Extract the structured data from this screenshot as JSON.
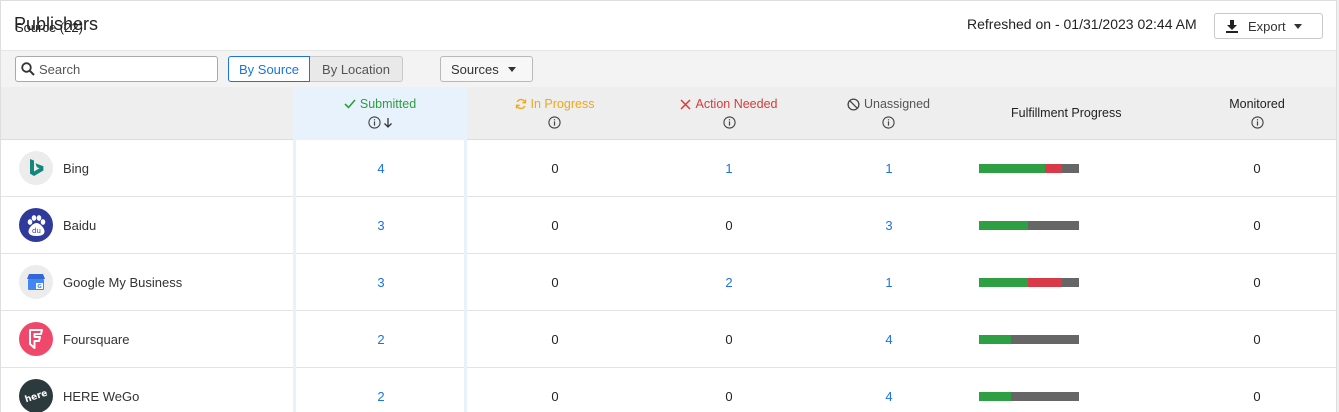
{
  "header": {
    "title": "Publishers",
    "refreshed": "Refreshed on - 01/31/2023 02:44 AM",
    "export_label": "Export"
  },
  "toolbar": {
    "search_placeholder": "Search",
    "by_source": "By Source",
    "by_location": "By Location",
    "sources": "Sources"
  },
  "table": {
    "headers": {
      "source": "Source (22)",
      "submitted": "Submitted",
      "in_progress": "In Progress",
      "action_needed": "Action Needed",
      "unassigned": "Unassigned",
      "fulfillment": "Fulfillment Progress",
      "monitored": "Monitored"
    },
    "rows": [
      {
        "name": "Bing",
        "submitted": "4",
        "in_progress": "0",
        "action_needed": "1",
        "unassigned": "1",
        "monitored": "0",
        "progress": {
          "green": 0.66,
          "red": 0.17
        }
      },
      {
        "name": "Baidu",
        "submitted": "3",
        "in_progress": "0",
        "action_needed": "0",
        "unassigned": "3",
        "monitored": "0",
        "progress": {
          "green": 0.49,
          "red": 0.0
        }
      },
      {
        "name": "Google My Business",
        "submitted": "3",
        "in_progress": "0",
        "action_needed": "2",
        "unassigned": "1",
        "monitored": "0",
        "progress": {
          "green": 0.49,
          "red": 0.34
        }
      },
      {
        "name": "Foursquare",
        "submitted": "2",
        "in_progress": "0",
        "action_needed": "0",
        "unassigned": "4",
        "monitored": "0",
        "progress": {
          "green": 0.32,
          "red": 0.0
        }
      },
      {
        "name": "HERE WeGo",
        "submitted": "2",
        "in_progress": "0",
        "action_needed": "0",
        "unassigned": "4",
        "monitored": "0",
        "progress": {
          "green": 0.32,
          "red": 0.0
        }
      }
    ]
  },
  "colors": {
    "accent": "#1a73e8",
    "submitted": "#2e9c3f",
    "in_progress": "#f0a818",
    "action_needed": "#d93a3a",
    "progress_green": "#2ea043",
    "progress_red": "#d93a4a",
    "progress_gray": "#666666"
  },
  "icons": {
    "search": "search-icon",
    "download": "download-icon",
    "caret": "caret-down-icon",
    "check": "check-icon",
    "sync": "sync-icon",
    "close": "close-icon",
    "block": "block-icon",
    "info": "info-icon",
    "sort": "arrow-down-icon"
  }
}
